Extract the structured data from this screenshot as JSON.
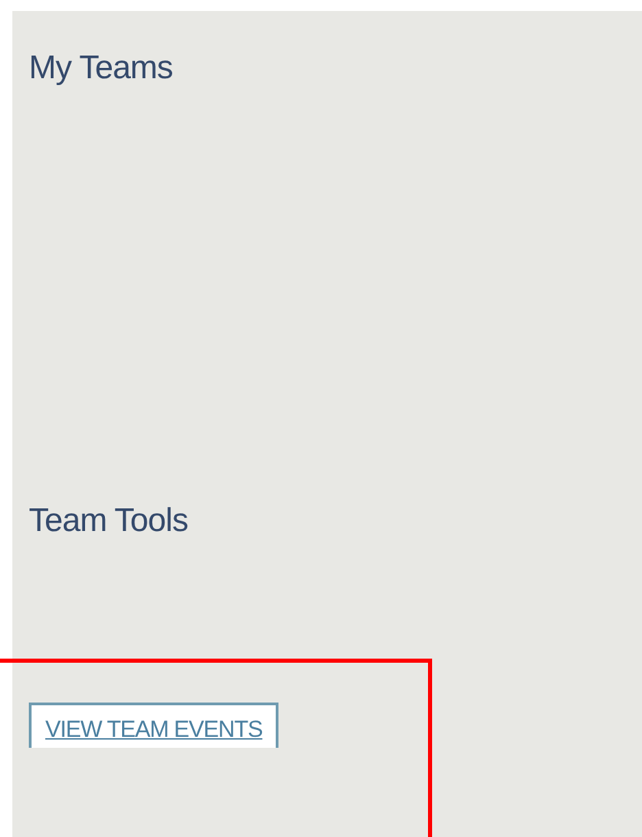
{
  "sections": [
    {
      "title": "My Teams"
    },
    {
      "title": "Team Tools"
    }
  ],
  "buttons": [
    {
      "label": "VIEW TEAM EVENTS",
      "highlighted": true
    }
  ]
}
